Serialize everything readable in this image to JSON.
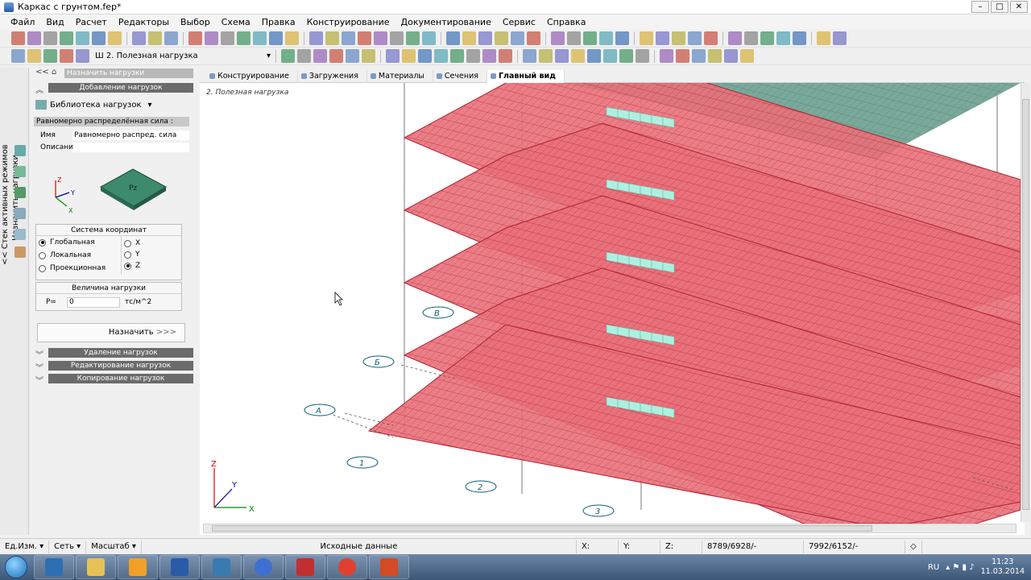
{
  "window": {
    "title": "Каркас с грунтом.fep*"
  },
  "menu": [
    "Файл",
    "Вид",
    "Расчет",
    "Редакторы",
    "Выбор",
    "Схема",
    "Правка",
    "Конструирование",
    "Документирование",
    "Сервис",
    "Справка"
  ],
  "toolbar2": {
    "load_case": "2. Полезная нагрузка",
    "load_case_prefix": "Ш"
  },
  "side_tab": {
    "label1": "<< Стек активных режимов",
    "label2": "Назначить нагрузки"
  },
  "panel": {
    "nav_title": "Назначить нагрузки",
    "add_section": "Добавление нагрузок",
    "library": "Библиотека нагрузок",
    "load_type": "Равномерно распределённая сила :",
    "name_label": "Имя",
    "name_value": "Равномерно распред. сила",
    "desc_label": "Описание",
    "desc_value": "",
    "icon_label": "Pz",
    "coord_system": {
      "title": "Система координат",
      "options": [
        "Глобальная",
        "Локальная",
        "Проекционная"
      ],
      "selected": "Глобальная",
      "axes": [
        "X",
        "Y",
        "Z"
      ],
      "axis_selected": "Z"
    },
    "magnitude": {
      "title": "Величина нагрузки",
      "label": "P=",
      "value": "0",
      "unit": "тс/м^2"
    },
    "assign_button": "Назначить",
    "assign_arrows": ">>>",
    "sections": [
      "Удаление нагрузок",
      "Редактирование нагрузок",
      "Копирование нагрузок"
    ]
  },
  "tabs": [
    {
      "label": "Конструирование",
      "active": false
    },
    {
      "label": "Загружения",
      "active": false
    },
    {
      "label": "Материалы",
      "active": false
    },
    {
      "label": "Сечения",
      "active": false
    },
    {
      "label": "Главный вид",
      "active": true
    }
  ],
  "view": {
    "caption": "2. Полезная нагрузка",
    "axis_letters": [
      "А",
      "Б",
      "В"
    ],
    "axis_numbers": [
      "1",
      "2",
      "3"
    ],
    "triad": {
      "x": "X",
      "y": "Y",
      "z": "Z"
    },
    "plate_color": "#e8707a",
    "roof_color": "#7aa89a",
    "highlight_color": "#aef0e0"
  },
  "status": {
    "units": "Ед.Изм.",
    "grid": "Сеть",
    "scale": "Масштаб",
    "mode": "Исходные данные",
    "x": "X:",
    "y": "Y:",
    "z": "Z:",
    "count1": "8789/6928/-",
    "count2": "7992/6152/-"
  },
  "taskbar": {
    "lang": "RU",
    "time": "11:23",
    "date": "11.03.2014"
  }
}
